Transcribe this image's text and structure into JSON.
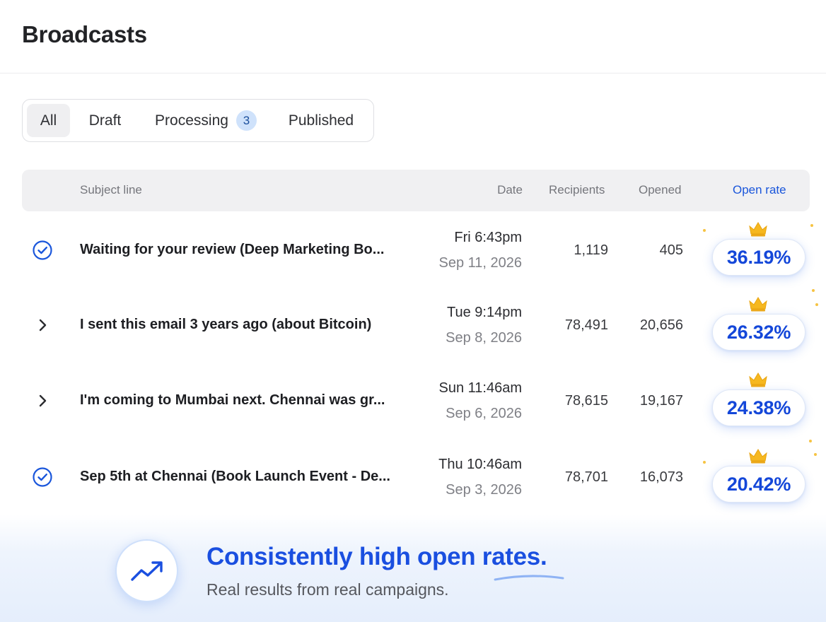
{
  "header": {
    "title": "Broadcasts"
  },
  "tabs": [
    {
      "label": "All",
      "active": true
    },
    {
      "label": "Draft",
      "active": false
    },
    {
      "label": "Processing",
      "badge": "3",
      "active": false
    },
    {
      "label": "Published",
      "active": false
    }
  ],
  "table": {
    "columns": {
      "subject": "Subject line",
      "date": "Date",
      "recipients": "Recipients",
      "opened": "Opened",
      "open_rate": "Open rate"
    },
    "rows": [
      {
        "icon": "check-circle-icon",
        "subject": "Waiting for your review (Deep Marketing Bo...",
        "time": "Fri 6:43pm",
        "date": "Sep 11, 2026",
        "recipients": "1,119",
        "opened": "405",
        "open_rate": "36.19%"
      },
      {
        "icon": "chevron-right-icon",
        "subject": "I sent this email 3 years ago (about Bitcoin)",
        "time": "Tue 9:14pm",
        "date": "Sep 8, 2026",
        "recipients": "78,491",
        "opened": "20,656",
        "open_rate": "26.32%"
      },
      {
        "icon": "chevron-right-icon",
        "subject": "I'm coming to Mumbai next. Chennai was gr...",
        "time": "Sun 11:46am",
        "date": "Sep 6, 2026",
        "recipients": "78,615",
        "opened": "19,167",
        "open_rate": "24.38%"
      },
      {
        "icon": "check-circle-icon",
        "subject": "Sep 5th at Chennai (Book Launch Event - De...",
        "time": "Thu 10:46am",
        "date": "Sep 3, 2026",
        "recipients": "78,701",
        "opened": "16,073",
        "open_rate": "20.42%"
      }
    ]
  },
  "footer": {
    "icon": "trending-up-icon",
    "title": "Consistently high open rates.",
    "subtitle": "Real results from real campaigns."
  },
  "colors": {
    "accent": "#1a56db",
    "crown": "#f6b820",
    "check": "#1a56db"
  }
}
